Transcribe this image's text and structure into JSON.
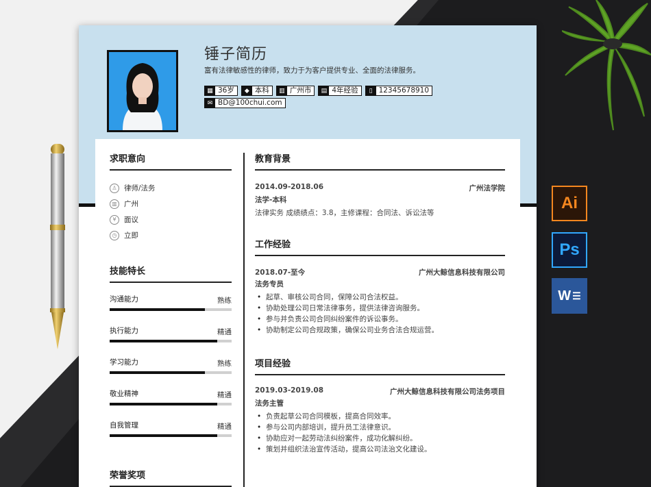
{
  "resume": {
    "name": "锤子简历",
    "intro": "富有法律敏感性的律师，致力于为客户提供专业、全面的法律服务。",
    "tags": [
      {
        "icon": "calendar-icon",
        "glyph": "▦",
        "text": "36岁"
      },
      {
        "icon": "graduation-cap-icon",
        "glyph": "◆",
        "text": "本科"
      },
      {
        "icon": "building-icon",
        "glyph": "▥",
        "text": "广州市"
      },
      {
        "icon": "briefcase-icon",
        "glyph": "▤",
        "text": "4年经验"
      },
      {
        "icon": "phone-icon",
        "glyph": "▯",
        "text": "12345678910"
      },
      {
        "icon": "mail-icon",
        "glyph": "✉",
        "text": "BD@100chui.com"
      }
    ],
    "intent": {
      "title": "求职意向",
      "items": [
        {
          "icon": "tie-icon",
          "glyph": "♙",
          "text": "律师/法务"
        },
        {
          "icon": "building-icon",
          "glyph": "▥",
          "text": "广州"
        },
        {
          "icon": "yen-icon",
          "glyph": "¥",
          "text": "面议"
        },
        {
          "icon": "clock-icon",
          "glyph": "◷",
          "text": "立即"
        }
      ]
    },
    "skills": {
      "title": "技能特长",
      "items": [
        {
          "name": "沟通能力",
          "level": "熟练",
          "value": 0.78
        },
        {
          "name": "执行能力",
          "level": "精通",
          "value": 0.88
        },
        {
          "name": "学习能力",
          "level": "熟练",
          "value": 0.78
        },
        {
          "name": "敬业精神",
          "level": "精通",
          "value": 0.88
        },
        {
          "name": "自我管理",
          "level": "精通",
          "value": 0.88
        }
      ]
    },
    "honors": {
      "title": "荣誉奖项"
    },
    "education": {
      "title": "教育背景",
      "date": "2014.09-2018.06",
      "school": "广州法学院",
      "major": "法学-本科",
      "desc": "法律实务 成绩绩点：3.8，主修课程：合同法、诉讼法等"
    },
    "work": {
      "title": "工作经验",
      "date": "2018.07-至今",
      "company": "广州大鲸信息科技有限公司",
      "position": "法务专员",
      "bullets": [
        "起草、审核公司合同，保障公司合法权益。",
        "协助处理公司日常法律事务，提供法律咨询服务。",
        "参与并负责公司合同纠纷案件的诉讼事务。",
        "协助制定公司合规政策，确保公司业务合法合规运营。"
      ]
    },
    "project": {
      "title": "项目经验",
      "date": "2019.03-2019.08",
      "company": "广州大鲸信息科技有限公司法务项目",
      "position": "法务主管",
      "bullets": [
        "负责起草公司合同模板，提高合同效率。",
        "参与公司内部培训，提升员工法律意识。",
        "协助应对一起劳动法纠纷案件，成功化解纠纷。",
        "策划并组织法治宣传活动，提高公司法治文化建设。"
      ]
    }
  },
  "apps": [
    {
      "icon": "illustrator-icon",
      "label": "Ai"
    },
    {
      "icon": "photoshop-icon",
      "label": "Ps"
    },
    {
      "icon": "word-icon",
      "label": "W"
    }
  ]
}
